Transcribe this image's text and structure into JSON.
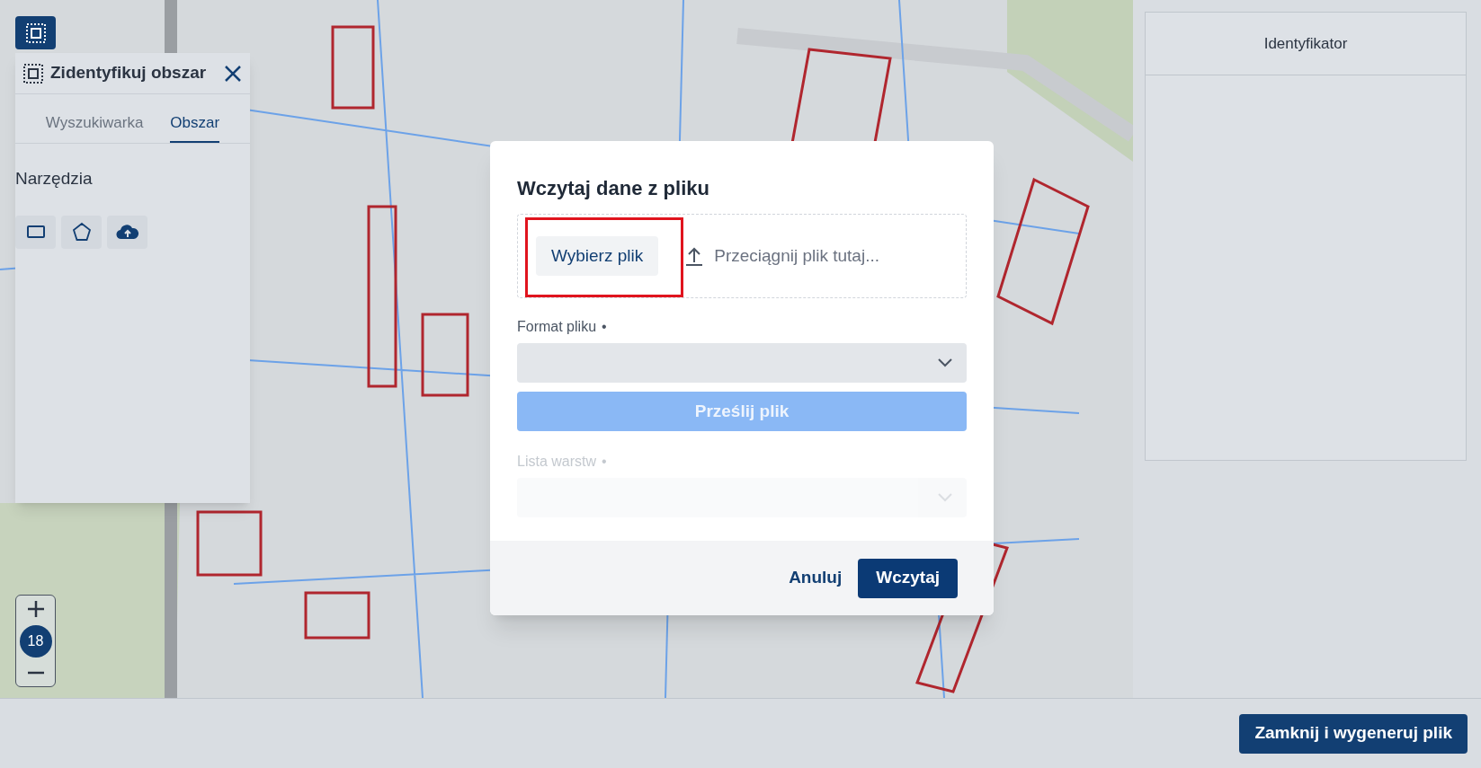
{
  "panel": {
    "title": "Zidentyfikuj obszar",
    "tabs": [
      {
        "label": "Wyszukiwarka",
        "selected": false
      },
      {
        "label": "Obszar",
        "selected": true
      }
    ],
    "section_label": "Narzędzia",
    "tools": [
      {
        "kind": "rectangle"
      },
      {
        "kind": "polygon"
      },
      {
        "kind": "upload"
      }
    ]
  },
  "zoom": {
    "level": "18"
  },
  "dialog": {
    "title": "Wczytaj dane z pliku",
    "choose_button": "Wybierz plik",
    "drop_hint": "Przeciągnij plik tutaj...",
    "fields": [
      {
        "label": "Format pliku",
        "marker": "•",
        "disabled": false
      },
      {
        "label": "Lista warstw",
        "marker": "•",
        "disabled": true
      }
    ],
    "upload_button": {
      "label": "Prześlij plik",
      "disabled": true
    },
    "cancel": "Anuluj",
    "submit": "Wczytaj"
  },
  "results": {
    "columns": [
      "Identyfikator"
    ]
  },
  "footer": {
    "button": "Zamknij i wygeneruj plik"
  }
}
